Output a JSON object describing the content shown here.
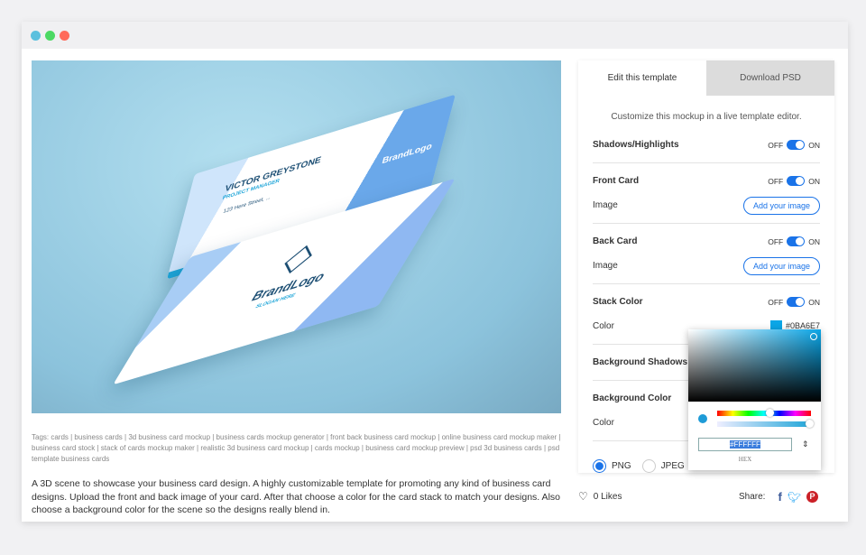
{
  "window": {
    "dots": [
      "#5bc0de",
      "#4cd964",
      "#ff6b5b"
    ]
  },
  "mockup": {
    "name": "VICTOR GREYSTONE",
    "role": "PROJECT MANAGER",
    "address": "123 Here Street, ...",
    "brand": "BrandLogo",
    "slogan": "SLOGAN HERE"
  },
  "tags": "Tags: cards | business cards | 3d business card mockup | business cards mockup generator | front back business card mockup | online business card mockup maker | business card stock | stack of cards mockup maker | realistic 3d business card mockup | cards mockup | business card mockup preview | psd 3d business cards | psd template business cards",
  "description": "A 3D scene to showcase your business card design. A highly customizable template for promoting any kind of business card designs. Upload the front and back image of your card. After that choose a color for the card stack to match your designs. Also choose a background color for the scene so the designs really blend in.",
  "panel": {
    "tabs": [
      {
        "label": "Edit this template",
        "active": true
      },
      {
        "label": "Download PSD",
        "active": false
      }
    ],
    "subtitle": "Customize this mockup in a live template editor.",
    "off": "OFF",
    "on": "ON",
    "shadows": "Shadows/Highlights",
    "front": {
      "title": "Front Card",
      "image": "Image",
      "button": "Add your image"
    },
    "back": {
      "title": "Back Card",
      "image": "Image",
      "button": "Add your image"
    },
    "stack": {
      "title": "Stack Color",
      "color_label": "Color",
      "value": "#0BA6E7"
    },
    "bg_shadows": "Background Shadows",
    "bg_color": {
      "title": "Background Color",
      "color_label": "Color"
    },
    "formats": [
      {
        "label": "PNG",
        "selected": true
      },
      {
        "label": "JPEG",
        "selected": false
      }
    ]
  },
  "picker": {
    "hex_value": "#FFFFFF",
    "mode": "HEX",
    "accent": "#0BA6E7"
  },
  "footer": {
    "likes": "0 Likes",
    "share": "Share:"
  }
}
